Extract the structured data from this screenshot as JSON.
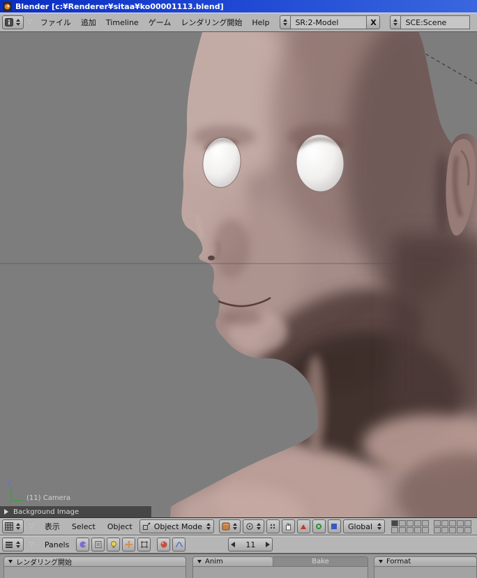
{
  "window": {
    "title": "Blender [c:¥Renderer¥sitaa¥ko00001113.blend]"
  },
  "menubar": {
    "menus": [
      "ファイル",
      "追加",
      "Timeline",
      "ゲーム",
      "レンダリング開始",
      "Help"
    ],
    "screen": {
      "value": "SR:2-Model",
      "close": "X"
    },
    "scene": {
      "value": "SCE:Scene"
    }
  },
  "viewport": {
    "view_label": "(11) Camera",
    "axis_z": "Z",
    "background_image": "Background Image"
  },
  "view_header": {
    "menus": [
      "表示",
      "Select",
      "Object"
    ],
    "mode": "Object Mode",
    "orientation": "Global"
  },
  "buttons_header": {
    "panels": "Panels",
    "frame": "11"
  },
  "panels": {
    "render": "レンダリング開始",
    "anim": "Anim",
    "bake": "Bake",
    "format": "Format"
  },
  "colors": {
    "titlebar_blue": "#1d45d2",
    "header_gray": "#b6b6b6",
    "viewport_gray": "#7d7d7d",
    "skin_tone": "#a58c88"
  }
}
